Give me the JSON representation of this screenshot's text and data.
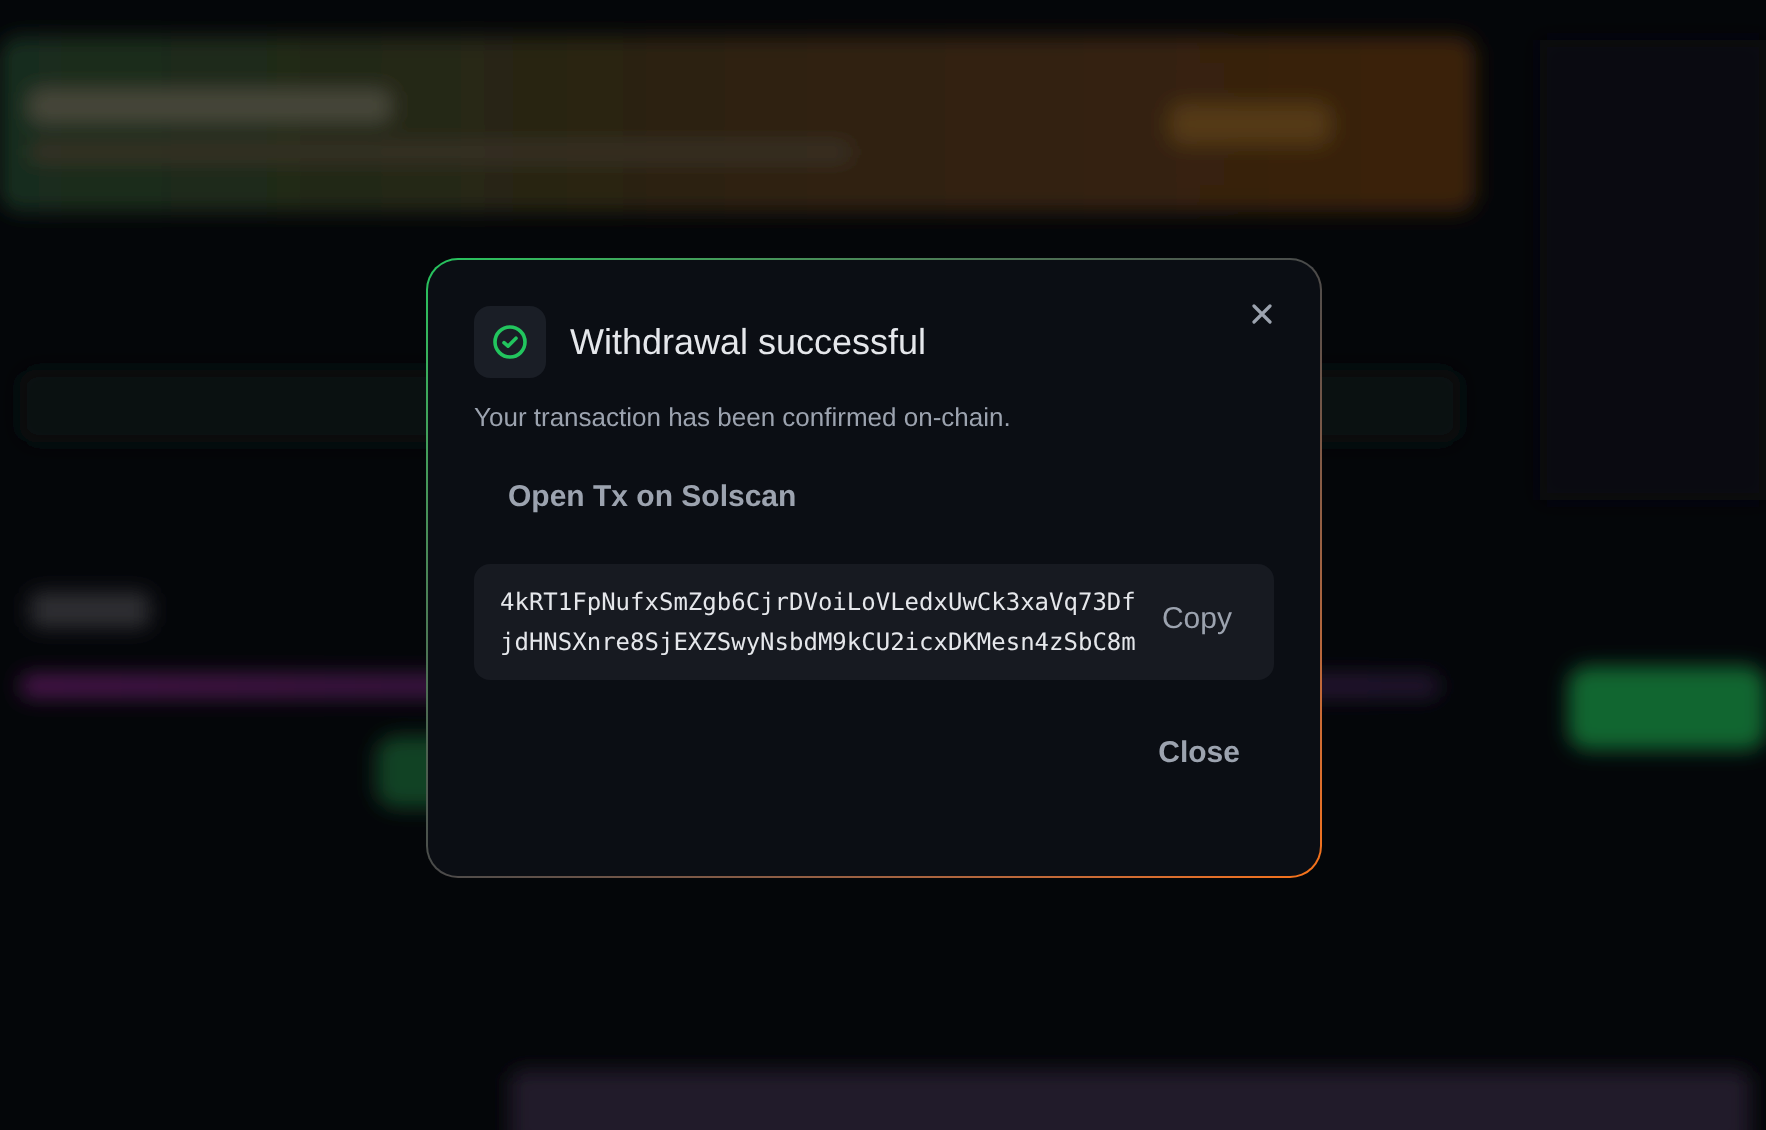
{
  "dialog": {
    "title": "Withdrawal successful",
    "message": "Your transaction has been confirmed on-chain.",
    "link": "Open Tx on Solscan",
    "tx_hash": "4kRT1FpNufxSmZgb6CjrDVoiLoVLedxUwCk3xaVq73DfjdHNSXnre8SjEXZSwyNsbdM9kCU2icxDKMesn4zSbC8m",
    "copy_button": "Copy",
    "close_button": "Close"
  }
}
